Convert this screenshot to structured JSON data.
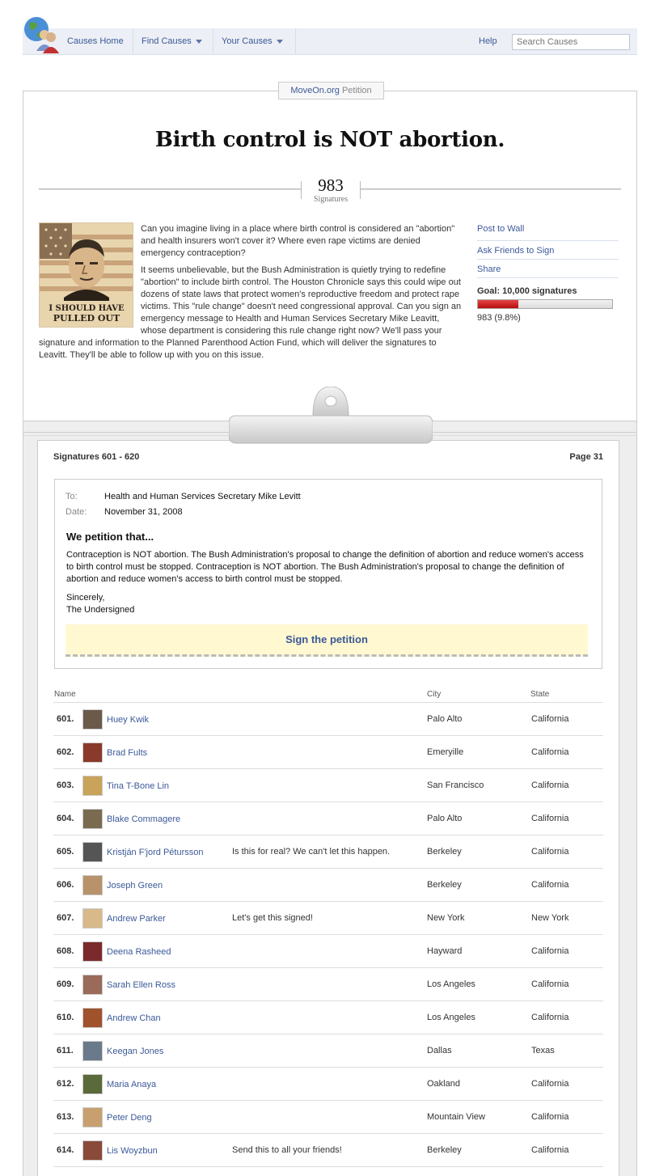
{
  "nav": {
    "home": "Causes Home",
    "find": "Find Causes",
    "yours": "Your Causes",
    "help": "Help",
    "search_placeholder": "Search Causes"
  },
  "petition": {
    "tag_brand": "MoveOn.org",
    "tag_label": "Petition",
    "title": "Birth control is NOT abortion.",
    "signature_count": "983",
    "signature_label": "Signatures",
    "poster_text": [
      "I SHOULD HAVE",
      "PULLED OUT"
    ],
    "paragraphs": [
      "Can you imagine living in a place where birth control is considered an \"abortion\" and health insurers won't cover it? Where even rape victims are denied emergency contraception?",
      "It seems unbelievable, but the Bush Administration is quietly trying to redefine \"abortion\" to include birth control. The Houston Chronicle says this could wipe out dozens of state laws that protect women's reproductive freedom and protect rape victims. This \"rule change\" doesn't need congressional approval. Can you sign an emergency message to Health and Human Services Secretary Mike Leavitt, whose department is considering this rule change right now? We'll pass your signature and information to the Planned Parenthood Action Fund, which will deliver the signatures to Leavitt. They'll be able to follow up with you on this issue."
    ]
  },
  "sidebar": {
    "links": [
      "Post to Wall",
      "Ask Friends to Sign",
      "Share"
    ],
    "goal": "Goal: 10,000 signatures",
    "progress_fraction": 0.098,
    "progress_text": "983 (9.8%)",
    "bar_color": "#c81b1b"
  },
  "signatures": {
    "range": "Signatures 601 - 620",
    "page": "Page 31",
    "letter": {
      "to_label": "To:",
      "to": "Health and Human Services Secretary Mike Levitt",
      "date_label": "Date:",
      "date": "November 31, 2008",
      "heading": "We petition that...",
      "text": "Contraception is NOT abortion. The Bush Administration's proposal to change the definition of abortion and reduce women's access to birth control must be stopped. Contraception is NOT abortion. The Bush Administration's proposal to change the definition of abortion and reduce women's access to birth control must be stopped.",
      "closing1": "Sincerely,",
      "closing2": "The Undersigned",
      "sign_button": "Sign the petition"
    },
    "columns": {
      "name": "Name",
      "city": "City",
      "state": "State"
    },
    "rows": [
      {
        "num": "601.",
        "name": "Huey Kwik",
        "comment": "",
        "city": "Palo Alto",
        "state": "California",
        "avatar_color": "#6b5a4a"
      },
      {
        "num": "602.",
        "name": "Brad Fults",
        "comment": "",
        "city": "Emeryille",
        "state": "California",
        "avatar_color": "#8a3a2a"
      },
      {
        "num": "603.",
        "name": "Tina T-Bone Lin",
        "comment": "",
        "city": "San Francisco",
        "state": "California",
        "avatar_color": "#c9a35a"
      },
      {
        "num": "604.",
        "name": "Blake Commagere",
        "comment": "",
        "city": "Palo Alto",
        "state": "California",
        "avatar_color": "#7a6a50"
      },
      {
        "num": "605.",
        "name": "Kristján F'jord Pétursson",
        "comment": "Is this for real? We can't let this happen.",
        "city": "Berkeley",
        "state": "California",
        "avatar_color": "#555555"
      },
      {
        "num": "606.",
        "name": "Joseph Green",
        "comment": "",
        "city": "Berkeley",
        "state": "California",
        "avatar_color": "#b8926a"
      },
      {
        "num": "607.",
        "name": "Andrew Parker",
        "comment": "Let's get this signed!",
        "city": "New York",
        "state": "New York",
        "avatar_color": "#d8b98a"
      },
      {
        "num": "608.",
        "name": "Deena Rasheed",
        "comment": "",
        "city": "Hayward",
        "state": "California",
        "avatar_color": "#7a2a2a"
      },
      {
        "num": "609.",
        "name": "Sarah Ellen Ross",
        "comment": "",
        "city": "Los Angeles",
        "state": "California",
        "avatar_color": "#9a6a5a"
      },
      {
        "num": "610.",
        "name": "Andrew Chan",
        "comment": "",
        "city": "Los Angeles",
        "state": "California",
        "avatar_color": "#a0522d"
      },
      {
        "num": "611.",
        "name": "Keegan Jones",
        "comment": "",
        "city": "Dallas",
        "state": "Texas",
        "avatar_color": "#6a7a8a"
      },
      {
        "num": "612.",
        "name": "Maria Anaya",
        "comment": "",
        "city": "Oakland",
        "state": "California",
        "avatar_color": "#5a6a3a"
      },
      {
        "num": "613.",
        "name": "Peter Deng",
        "comment": "",
        "city": "Mountain View",
        "state": "California",
        "avatar_color": "#c8a070"
      },
      {
        "num": "614.",
        "name": "Lis Woyzbun",
        "comment": "Send this to all your friends!",
        "city": "Berkeley",
        "state": "California",
        "avatar_color": "#8a4a3a"
      }
    ]
  }
}
